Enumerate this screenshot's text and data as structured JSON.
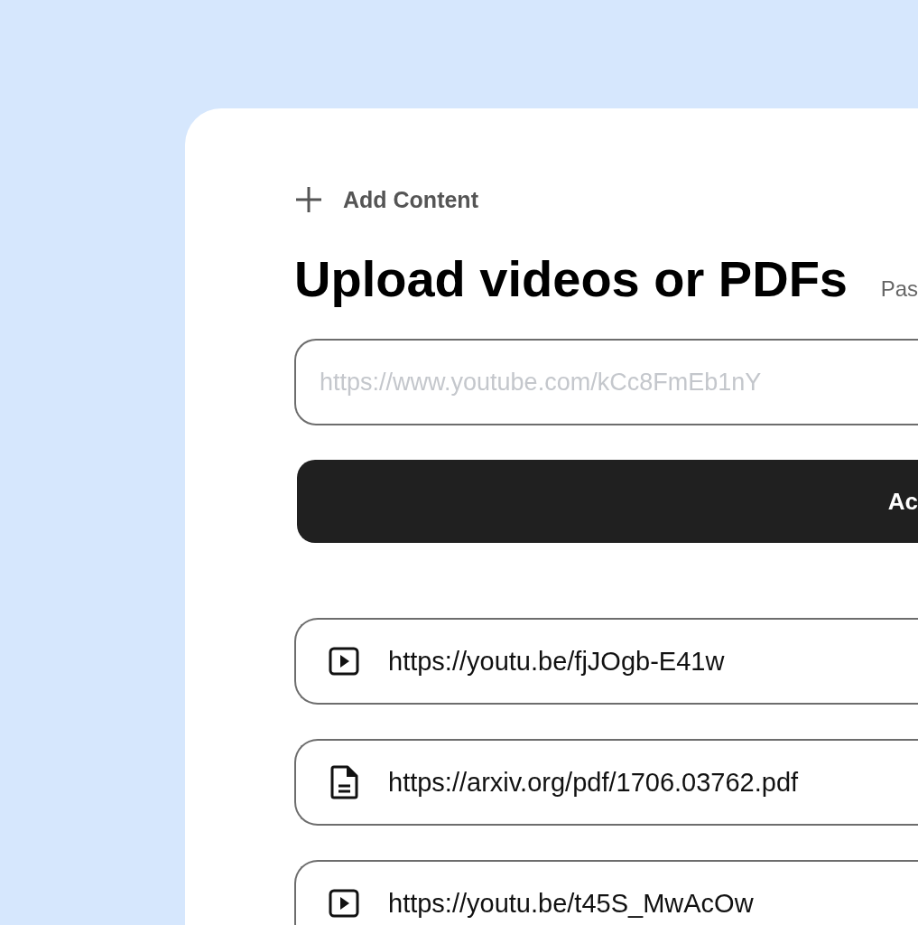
{
  "header": {
    "label": "Add Content"
  },
  "title": "Upload videos or PDFs",
  "subtitle": "Pas",
  "url_input": {
    "placeholder": "https://www.youtube.com/kCc8FmEb1nY"
  },
  "add_button": {
    "label": "Ac"
  },
  "items": [
    {
      "kind": "video",
      "url": "https://youtu.be/fjJOgb-E41w"
    },
    {
      "kind": "pdf",
      "url": "https://arxiv.org/pdf/1706.03762.pdf"
    },
    {
      "kind": "video",
      "url": "https://youtu.be/t45S_MwAcOw"
    }
  ]
}
